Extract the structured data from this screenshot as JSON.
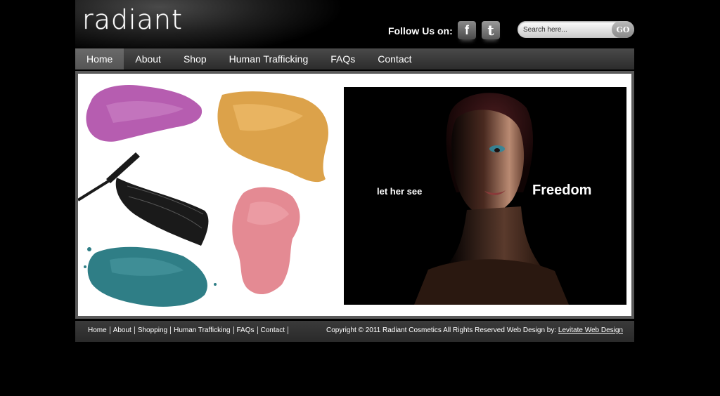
{
  "header": {
    "logo": "radiant",
    "follow_label": "Follow Us on:",
    "facebook_glyph": "f",
    "twitter_glyph": "t",
    "search_placeholder": "Search here...",
    "go_label": "GO"
  },
  "nav": {
    "items": [
      {
        "label": "Home",
        "active": true
      },
      {
        "label": "About"
      },
      {
        "label": "Shop"
      },
      {
        "label": "Human Trafficking"
      },
      {
        "label": "FAQs"
      },
      {
        "label": "Contact"
      }
    ]
  },
  "hero": {
    "tagline_small": "let her see",
    "tagline_big": "Freedom"
  },
  "footer": {
    "links": [
      "Home",
      "About",
      "Shopping",
      "Human Trafficking",
      "FAQs",
      "Contact"
    ],
    "copyright": "Copyright © 2011 Radiant Cosmetics All Rights Reserved Web Design by:",
    "credit_link": "Levitate Web Design"
  },
  "colors": {
    "pink_shadow": "#b65db0",
    "gold_shadow": "#dca24a",
    "rose_shadow": "#e48a93",
    "teal_shadow": "#2f7e86",
    "mascara": "#1a1a1a"
  }
}
